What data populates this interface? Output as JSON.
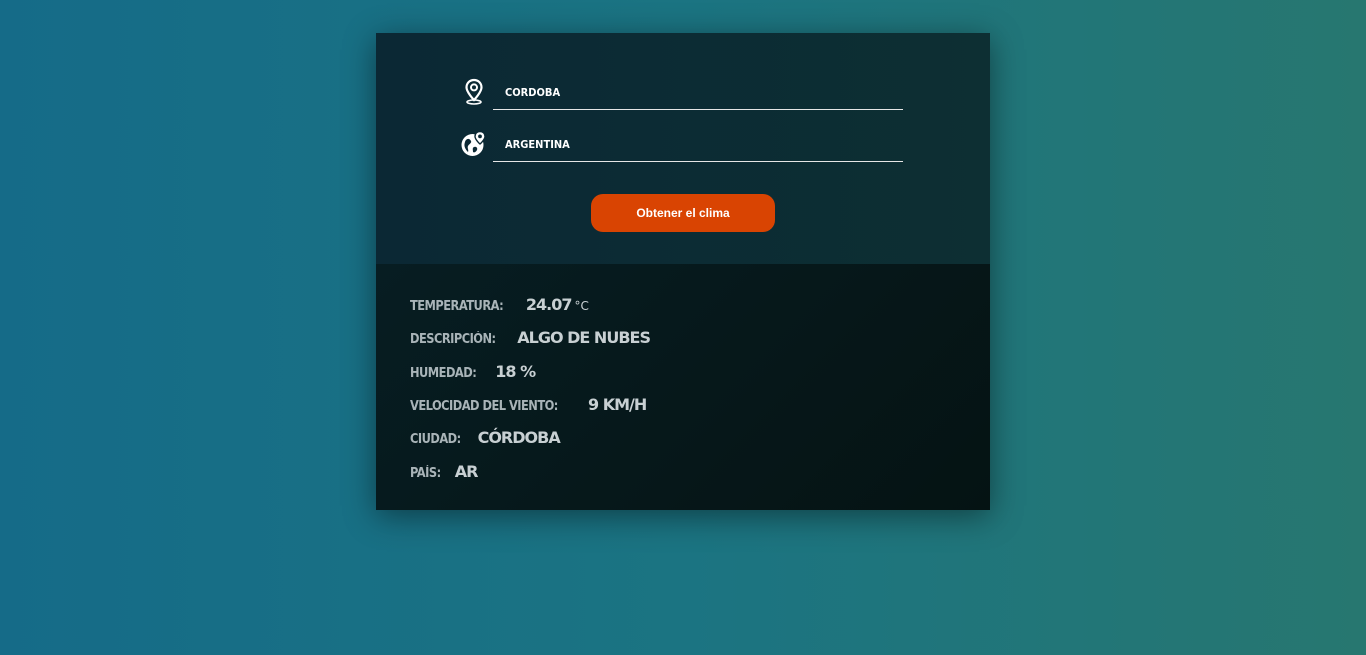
{
  "form": {
    "city_value": "CORDOBA",
    "country_value": "ARGENTINA",
    "submit_label": "Obtener el clima"
  },
  "results": {
    "temperature": {
      "label": "Temperatura:",
      "value": "24.07",
      "unit": "°C"
    },
    "description": {
      "label": "Descripción:",
      "value": "algo de nubes"
    },
    "humidity": {
      "label": "Humedad:",
      "value": "18 %"
    },
    "wind": {
      "label": "Velocidad del viento:",
      "value": "9 km/h"
    },
    "city": {
      "label": "Ciudad:",
      "value": "Córdoba"
    },
    "country": {
      "label": "País:",
      "value": "AR"
    }
  },
  "icons": {
    "city_icon": "map-pin-icon",
    "country_icon": "globe-pin-icon"
  },
  "colors": {
    "button": "#d94402",
    "form_panel": "#0b2834",
    "result_panel": "#061818"
  }
}
